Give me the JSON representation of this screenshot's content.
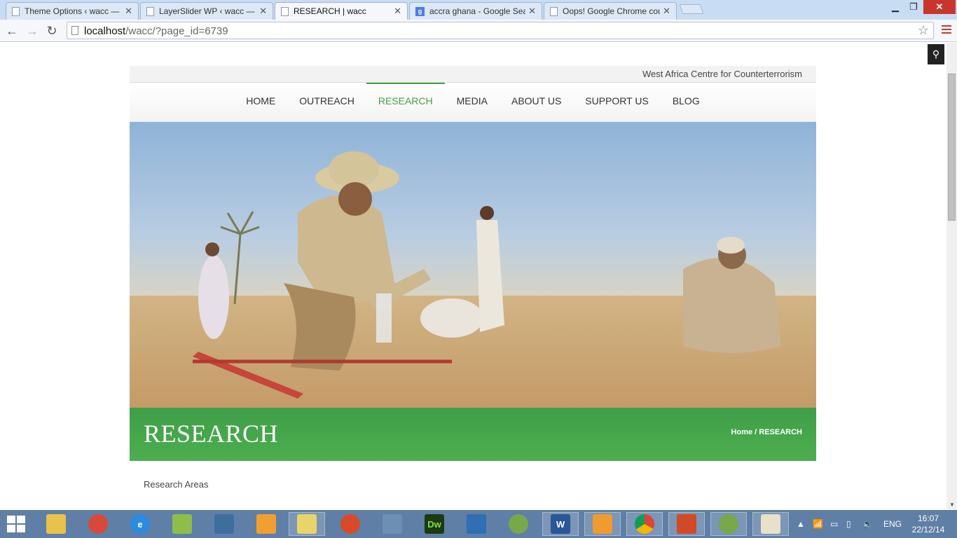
{
  "browser": {
    "tabs": [
      {
        "title": "Theme Options ‹ wacc —",
        "icon": "page-icon",
        "active": false
      },
      {
        "title": "LayerSlider WP ‹ wacc — V",
        "icon": "page-icon",
        "active": false
      },
      {
        "title": "RESEARCH | wacc",
        "icon": "page-icon",
        "active": true
      },
      {
        "title": "accra ghana - Google Sear",
        "icon": "google-icon",
        "active": false
      },
      {
        "title": "Oops! Google Chrome cou",
        "icon": "page-icon",
        "active": false
      }
    ],
    "url_host": "localhost",
    "url_path": "/wacc/?page_id=6739"
  },
  "site": {
    "tagline": "West Africa Centre for Counterterrorism",
    "nav": [
      "HOME",
      "OUTREACH",
      "RESEARCH",
      "MEDIA",
      "ABOUT US",
      "SUPPORT US",
      "BLOG"
    ],
    "active_nav": "RESEARCH",
    "accent_color": "#43a047",
    "page_title": "RESEARCH",
    "breadcrumb": "Home / RESEARCH",
    "content_heading": "Research Areas"
  },
  "taskbar": {
    "icons": [
      "file-explorer-icon",
      "paint-camera-icon",
      "internet-explorer-icon",
      "notepad-icon",
      "photo-viewer-icon",
      "avatar-app-icon",
      "folder-icon",
      "firefox-icon",
      "calculator-icon",
      "dreamweaver-icon",
      "box-app-icon",
      "android-studio-icon",
      "word-icon",
      "media-player-icon",
      "chrome-icon",
      "app-icon",
      "android-studio-icon-2",
      "paint-icon"
    ],
    "dreamweaver_label": "Dw",
    "word_label": "W",
    "language": "ENG",
    "time": "16:07",
    "date": "22/12/14"
  }
}
